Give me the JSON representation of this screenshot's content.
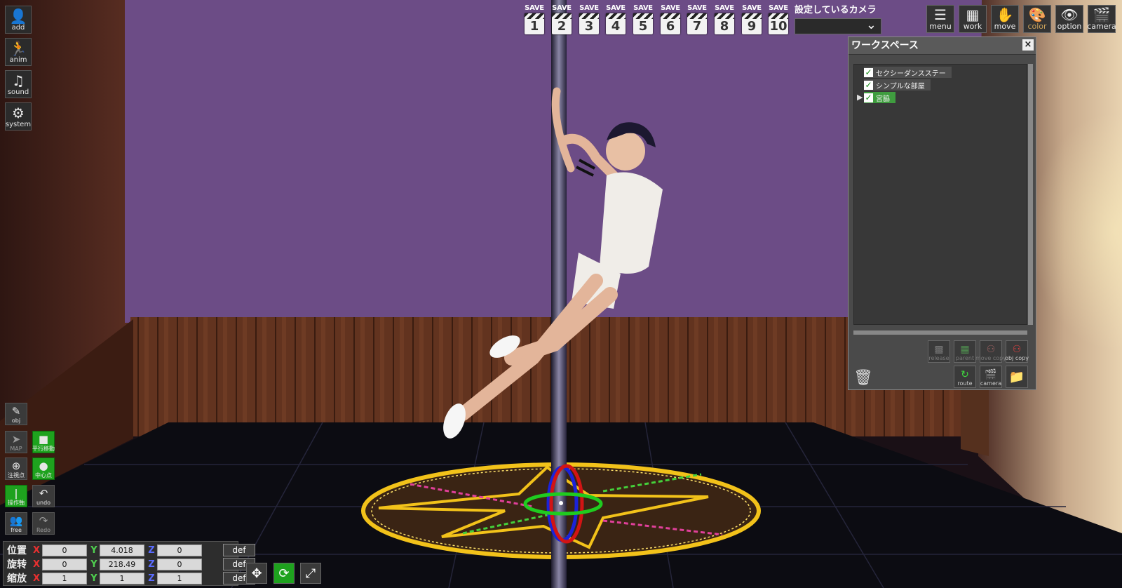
{
  "left_toolbar": [
    {
      "id": "add",
      "label": "add",
      "icon": "user-add-icon"
    },
    {
      "id": "anim",
      "label": "anim",
      "icon": "running-figure-icon"
    },
    {
      "id": "sound",
      "label": "sound",
      "icon": "music-note-icon"
    },
    {
      "id": "system",
      "label": "system",
      "icon": "gears-icon"
    }
  ],
  "save_slots": [
    {
      "label": "SAVE",
      "num": "1"
    },
    {
      "label": "SAVE",
      "num": "2"
    },
    {
      "label": "SAVE",
      "num": "3"
    },
    {
      "label": "SAVE",
      "num": "4"
    },
    {
      "label": "SAVE",
      "num": "5"
    },
    {
      "label": "SAVE",
      "num": "6"
    },
    {
      "label": "SAVE",
      "num": "7"
    },
    {
      "label": "SAVE",
      "num": "8"
    },
    {
      "label": "SAVE",
      "num": "9"
    },
    {
      "label": "SAVE",
      "num": "10"
    }
  ],
  "camera_select": {
    "title": "設定しているカメラ",
    "value": ""
  },
  "right_toolbar": [
    {
      "id": "menu",
      "label": "menu",
      "icon": "menu-list-icon"
    },
    {
      "id": "work",
      "label": "work",
      "icon": "workspace-icon"
    },
    {
      "id": "move",
      "label": "move",
      "icon": "hand-icon"
    },
    {
      "id": "color",
      "label": "color",
      "icon": "palette-icon"
    },
    {
      "id": "option",
      "label": "option",
      "icon": "eye-icon"
    },
    {
      "id": "camera",
      "label": "camera",
      "icon": "clapper-icon"
    }
  ],
  "workspace": {
    "title": "ワークスペース",
    "close": "×",
    "items": [
      {
        "label": "セクシーダンスステー",
        "checked": true
      },
      {
        "label": "シンプルな部屋",
        "checked": true
      },
      {
        "label": "宮脇",
        "checked": true,
        "selected": true
      }
    ],
    "buttons": [
      {
        "label": "release",
        "icon": "release-icon"
      },
      {
        "label": "parent",
        "icon": "parent-icon"
      },
      {
        "label": "move copy",
        "icon": "move-copy-icon"
      },
      {
        "label": "obj copy",
        "icon": "obj-copy-icon"
      },
      {
        "label": "route",
        "icon": "route-icon"
      },
      {
        "label": "camera",
        "icon": "clapper-icon"
      }
    ]
  },
  "side_tools": [
    {
      "label": "obj",
      "icon": "edit-icon"
    },
    {
      "label": "MAP",
      "icon": "map-pin-icon"
    },
    {
      "label": "平行移動",
      "icon": "square-icon"
    },
    {
      "label": "注視点",
      "icon": "plus-circle-icon"
    },
    {
      "label": "中心点",
      "icon": "dot-icon"
    },
    {
      "label": "操作軸",
      "icon": "axis-icon"
    },
    {
      "label": "undo",
      "icon": "undo-icon"
    },
    {
      "label": "free",
      "icon": "people-icon"
    },
    {
      "label": "Redo",
      "icon": "redo-icon"
    }
  ],
  "transform": {
    "rows": [
      {
        "label": "位置",
        "x": "0",
        "y": "4.018",
        "z": "0",
        "def": "def"
      },
      {
        "label": "旋转",
        "x": "0",
        "y": "218.49",
        "z": "0",
        "def": "def"
      },
      {
        "label": "缩放",
        "x": "1",
        "y": "1",
        "z": "1",
        "def": "def"
      }
    ],
    "axes": {
      "x": "X",
      "y": "Y",
      "z": "Z"
    }
  },
  "colors": {
    "accent_green": "#1ea21e",
    "axis_x": "#e53030",
    "axis_y": "#4fd04f",
    "axis_z": "#5a6cff"
  }
}
